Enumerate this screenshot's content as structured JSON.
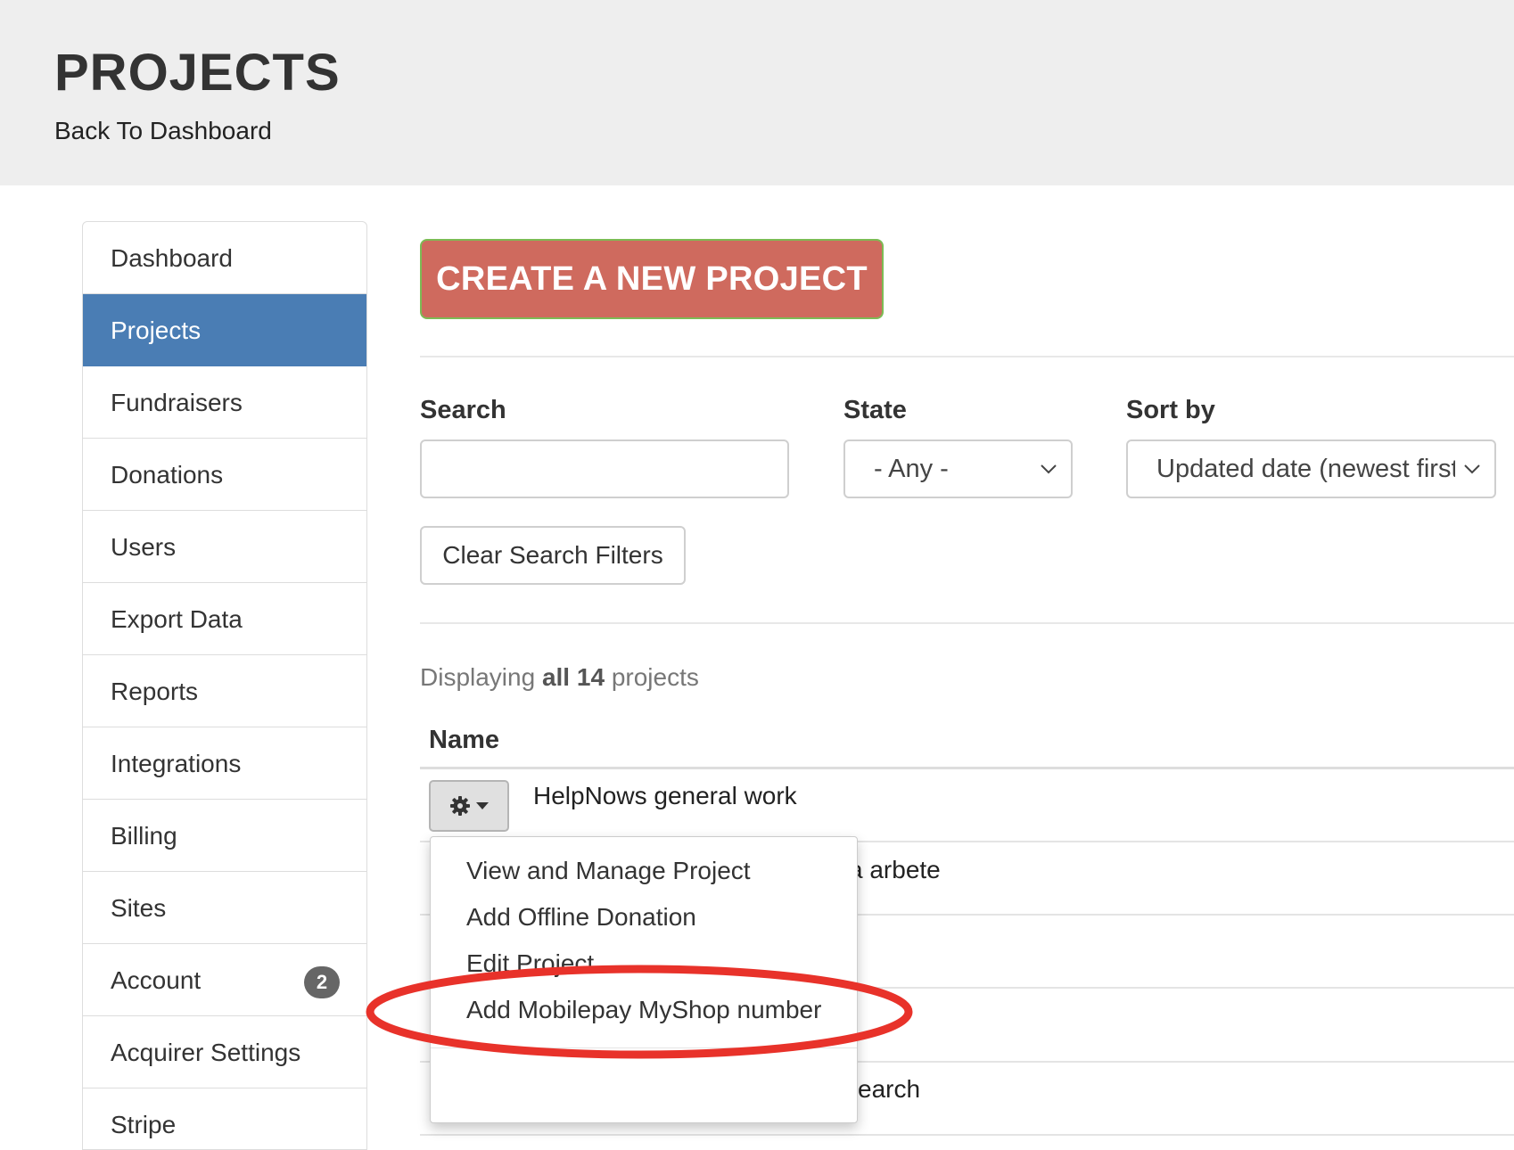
{
  "header": {
    "title": "PROJECTS",
    "back_link": "Back To Dashboard"
  },
  "sidebar": {
    "items": [
      {
        "label": "Dashboard"
      },
      {
        "label": "Projects",
        "active": true
      },
      {
        "label": "Fundraisers"
      },
      {
        "label": "Donations"
      },
      {
        "label": "Users"
      },
      {
        "label": "Export Data"
      },
      {
        "label": "Reports"
      },
      {
        "label": "Integrations"
      },
      {
        "label": "Billing"
      },
      {
        "label": "Sites"
      },
      {
        "label": "Account",
        "badge": "2"
      },
      {
        "label": "Acquirer Settings"
      },
      {
        "label": "Stripe"
      }
    ]
  },
  "main": {
    "create_button": "CREATE A NEW PROJECT",
    "filters": {
      "search_label": "Search",
      "search_value": "",
      "state_label": "State",
      "state_value": "- Any -",
      "sort_label": "Sort by",
      "sort_value": "Updated date (newest first)",
      "clear_button": "Clear Search Filters"
    },
    "results": {
      "prefix": "Displaying",
      "all": "all",
      "count": "14",
      "suffix": "projects"
    },
    "table": {
      "column_name": "Name",
      "rows": [
        {
          "name": "HelpNows general work"
        },
        {
          "name": "a arbete"
        },
        {
          "name": ""
        },
        {
          "name": ""
        },
        {
          "name": "earch"
        }
      ]
    },
    "action_menu": {
      "items": [
        "View and Manage Project",
        "Add Offline Donation",
        "Edit Project",
        "Add Mobilepay MyShop number"
      ],
      "highlighted_item": "Add Mobilepay MyShop number"
    }
  },
  "colors": {
    "header_bg": "#eeeeee",
    "active_nav": "#4a7db4",
    "create_button": "#cf6a5e",
    "create_button_border": "#7dbb55",
    "highlight_ellipse": "#e8322a"
  }
}
